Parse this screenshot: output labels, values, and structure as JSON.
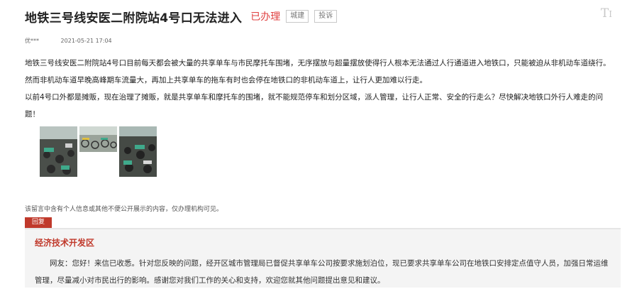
{
  "header": {
    "title": "地铁三号线安医二附院站4号口无法进入",
    "status": "已办理",
    "tags": [
      "城建",
      "投诉"
    ]
  },
  "meta": {
    "author": "优***",
    "date": "2021-05-21 17:04"
  },
  "content": {
    "paragraphs": [
      "地铁三号线安医二附院站4号口目前每天都会被大量的共享单车与市民摩托车围堵，无序摆放与超量摆放使得行人根本无法通过人行通道进入地铁口，只能被迫从非机动车道绕行。然而非机动车道早晚高峰期车流量大，再加上共享单车的拖车有时也会停在地铁口的非机动车道上，让行人更加难以行走。",
      "以前4号口外都是摊贩，现在治理了摊贩，就是共享单车和摩托车的围堵，就不能规范停车和划分区域，派人管理，让行人正常、安全的行走么？尽快解决地铁口外行人难走的问题！"
    ]
  },
  "photos": [
    {
      "icon": "photo-scooters"
    },
    {
      "icon": "photo-bikes"
    },
    {
      "icon": "photo-scooters"
    }
  ],
  "disclaimer": "该留言中含有个人信息或其他不便公开展示的内容，仅办理机构可见。",
  "reply": {
    "badge": "回复",
    "org": "经济技术开发区",
    "text": "网友：您好！来信已收悉。针对您反映的问题，经开区城市管理局已督促共享单车公司按要求施划泊位，现已要求共享单车公司在地铁口安排定点值守人员，加强日常运维管理，尽量减小对市民出行的影响。感谢您对我们工作的关心和支持，欢迎您就其他问题提出意见和建议。"
  },
  "colors": {
    "status": "#e04040",
    "reply_accent": "#c0392b"
  }
}
